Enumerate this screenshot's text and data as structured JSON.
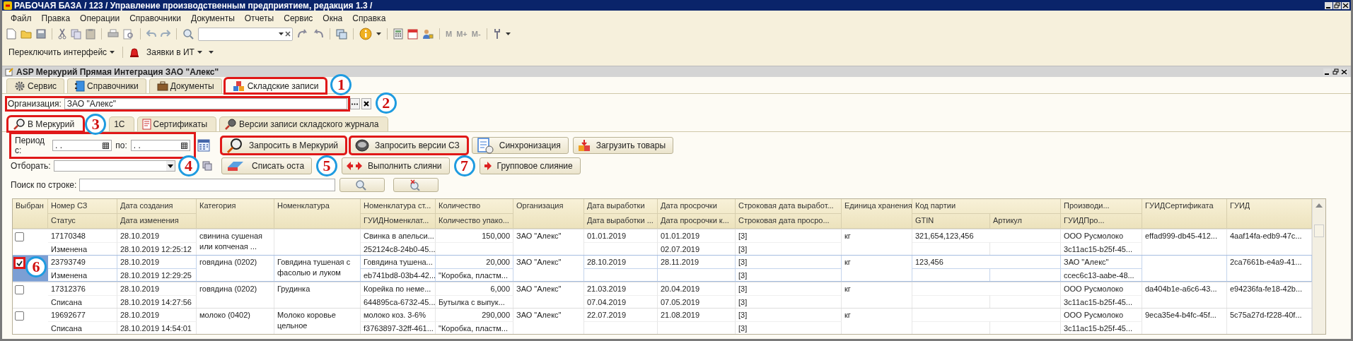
{
  "window": {
    "title": "РАБОЧАЯ БАЗА / 123 /  Управление производственным предприятием, редакция 1.3 /"
  },
  "menu": [
    "Файл",
    "Правка",
    "Операции",
    "Справочники",
    "Документы",
    "Отчеты",
    "Сервис",
    "Окна",
    "Справка"
  ],
  "memory_buttons": [
    "M",
    "M+",
    "M-"
  ],
  "panel_toolbar": [
    "Переключить интерфейс",
    "Заявки в ИТ"
  ],
  "form": {
    "title": "ASP Меркурий Прямая Интеграция ЗАО \"Алекс\""
  },
  "sections": [
    {
      "label": "Сервис",
      "selected": false
    },
    {
      "label": "Справочники",
      "selected": false
    },
    {
      "label": "Документы",
      "selected": false
    },
    {
      "label": "Складские записи",
      "selected": true,
      "callout": "1"
    }
  ],
  "organization": {
    "label": "Организация:",
    "value": "ЗАО \"Алекс\"",
    "callout": "2"
  },
  "tabs": [
    {
      "label": "В Меркурий",
      "selected": true,
      "callout": "3"
    },
    {
      "label": "1С",
      "selected": false
    },
    {
      "label": "Сертификаты",
      "selected": false
    },
    {
      "label": "Версии записи складского журнала",
      "selected": false
    }
  ],
  "period": {
    "from_label": "Период с:",
    "from_value": ". .",
    "to_label": "по:",
    "to_value": ". .",
    "callout": "4"
  },
  "filter": {
    "label": "Отборать:"
  },
  "search": {
    "label": "Поиск по строке:"
  },
  "request_buttons": [
    {
      "label": "Запросить в Меркурий",
      "callout": "5"
    },
    {
      "label": "Запросить версии СЗ",
      "callout": "7"
    },
    {
      "label": "Синхронизация"
    },
    {
      "label": "Загрузить товары"
    }
  ],
  "process_buttons": [
    {
      "label": "Списать оста"
    },
    {
      "label": "Выполнить слияни"
    },
    {
      "label": "Групповое слияние"
    }
  ],
  "table": {
    "columns": [
      "Выбран",
      "Номер СЗ",
      "Дата создания",
      "Категория",
      "Номенклатура",
      "Номенклатура ст...",
      "Количество",
      "Организация",
      "Дата выработки",
      "Дата просрочки",
      "Строковая дата выработ...",
      "Единица хранения",
      "Код партии",
      "Производи...",
      "ГУИДСертификата",
      "ГУИД",
      "Статус",
      "Дата изменения",
      "ГУИДНоменклат...",
      "Количество упако...",
      "Дата выработки ...",
      "Дата просрочки к...",
      "Строковая дата просро...",
      "GTIN",
      "Артикул",
      "ГУИДПро..."
    ],
    "rows": [
      {
        "checked": false,
        "selected": false,
        "num": "17170348",
        "status": "Изменена",
        "created": "28.10.2019",
        "modified": "28.10.2019 12:25:12",
        "category": "свинина сушеная или копченая ...",
        "merc": "Свинка в апельси...",
        "merc_guid": "252124c8-24b0-45...",
        "qty": "150,000",
        "org": "ЗАО \"Алекс\"",
        "prod": "01.01.2019",
        "exp": "01.01.2019",
        "exp2": "02.07.2019",
        "sprod": "[3]",
        "sexp": "[3]",
        "unit": "кг",
        "batch": "321,654,123,456",
        "producer": "ООО Русмолоко",
        "producer_guid": "3c11ac15-b25f-45...",
        "cert": "effad999-db45-412...",
        "guid": "4aaf14fa-edb9-47c..."
      },
      {
        "checked": true,
        "selected": true,
        "callout": "6",
        "num": "23793749",
        "status": "Изменена",
        "created": "28.10.2019",
        "modified": "28.10.2019 12:29:25",
        "category": "говядина (0202)",
        "nomenclature": "Говядина тушеная с фасолью и луком",
        "merc": "Говядина тушена...",
        "merc_guid": "eb741bd8-03b4-42...",
        "qty": "20,000",
        "pack": "\"Коробка, пластм...",
        "org": "ЗАО \"Алекс\"",
        "prod": "28.10.2019",
        "exp": "28.11.2019",
        "sprod": "[3]",
        "sexp": "[3]",
        "unit": "кг",
        "batch": "123,456",
        "producer": "ЗАО \"Алекс\"",
        "producer_guid": "ccec6c13-aabe-48...",
        "guid": "2ca7661b-e4a9-41..."
      },
      {
        "checked": false,
        "selected": false,
        "num": "17312376",
        "status": "Списана",
        "created": "28.10.2019",
        "modified": "28.10.2019 14:27:56",
        "category": "говядина (0202)",
        "nomenclature": "Грудинка",
        "merc": "Корейка по неме...",
        "merc_guid": "644895ca-6732-45...",
        "qty": "6,000",
        "pack": "Бутылка с выпук...",
        "org": "ЗАО \"Алекс\"",
        "prod": "21.03.2019",
        "prod2": "07.04.2019",
        "exp": "20.04.2019",
        "exp2": "07.05.2019",
        "sprod": "[3]",
        "sexp": "[3]",
        "unit": "кг",
        "producer": "ООО Русмолоко",
        "producer_guid": "3c11ac15-b25f-45...",
        "cert": "da404b1e-a6c6-43...",
        "guid": "e94236fa-fe18-42b..."
      },
      {
        "checked": false,
        "selected": false,
        "num": "19692677",
        "status": "Списана",
        "created": "28.10.2019",
        "modified": "28.10.2019 14:54:01",
        "category": "молоко (0402)",
        "nomenclature": "Молоко коровье цельное",
        "merc": "молоко коз. 3-6%",
        "merc_guid": "f3763897-32ff-461...",
        "qty": "290,000",
        "pack": "\"Коробка, пластм...",
        "org": "ЗАО \"Алекс\"",
        "prod": "22.07.2019",
        "exp": "21.08.2019",
        "sprod": "[3]",
        "sexp": "[3]",
        "unit": "кг",
        "producer": "ООО Русмолоко",
        "producer_guid": "3c11ac15-b25f-45...",
        "cert": "9eca35e4-b4fc-45f...",
        "guid": "5c75a27d-f228-40f..."
      }
    ]
  }
}
